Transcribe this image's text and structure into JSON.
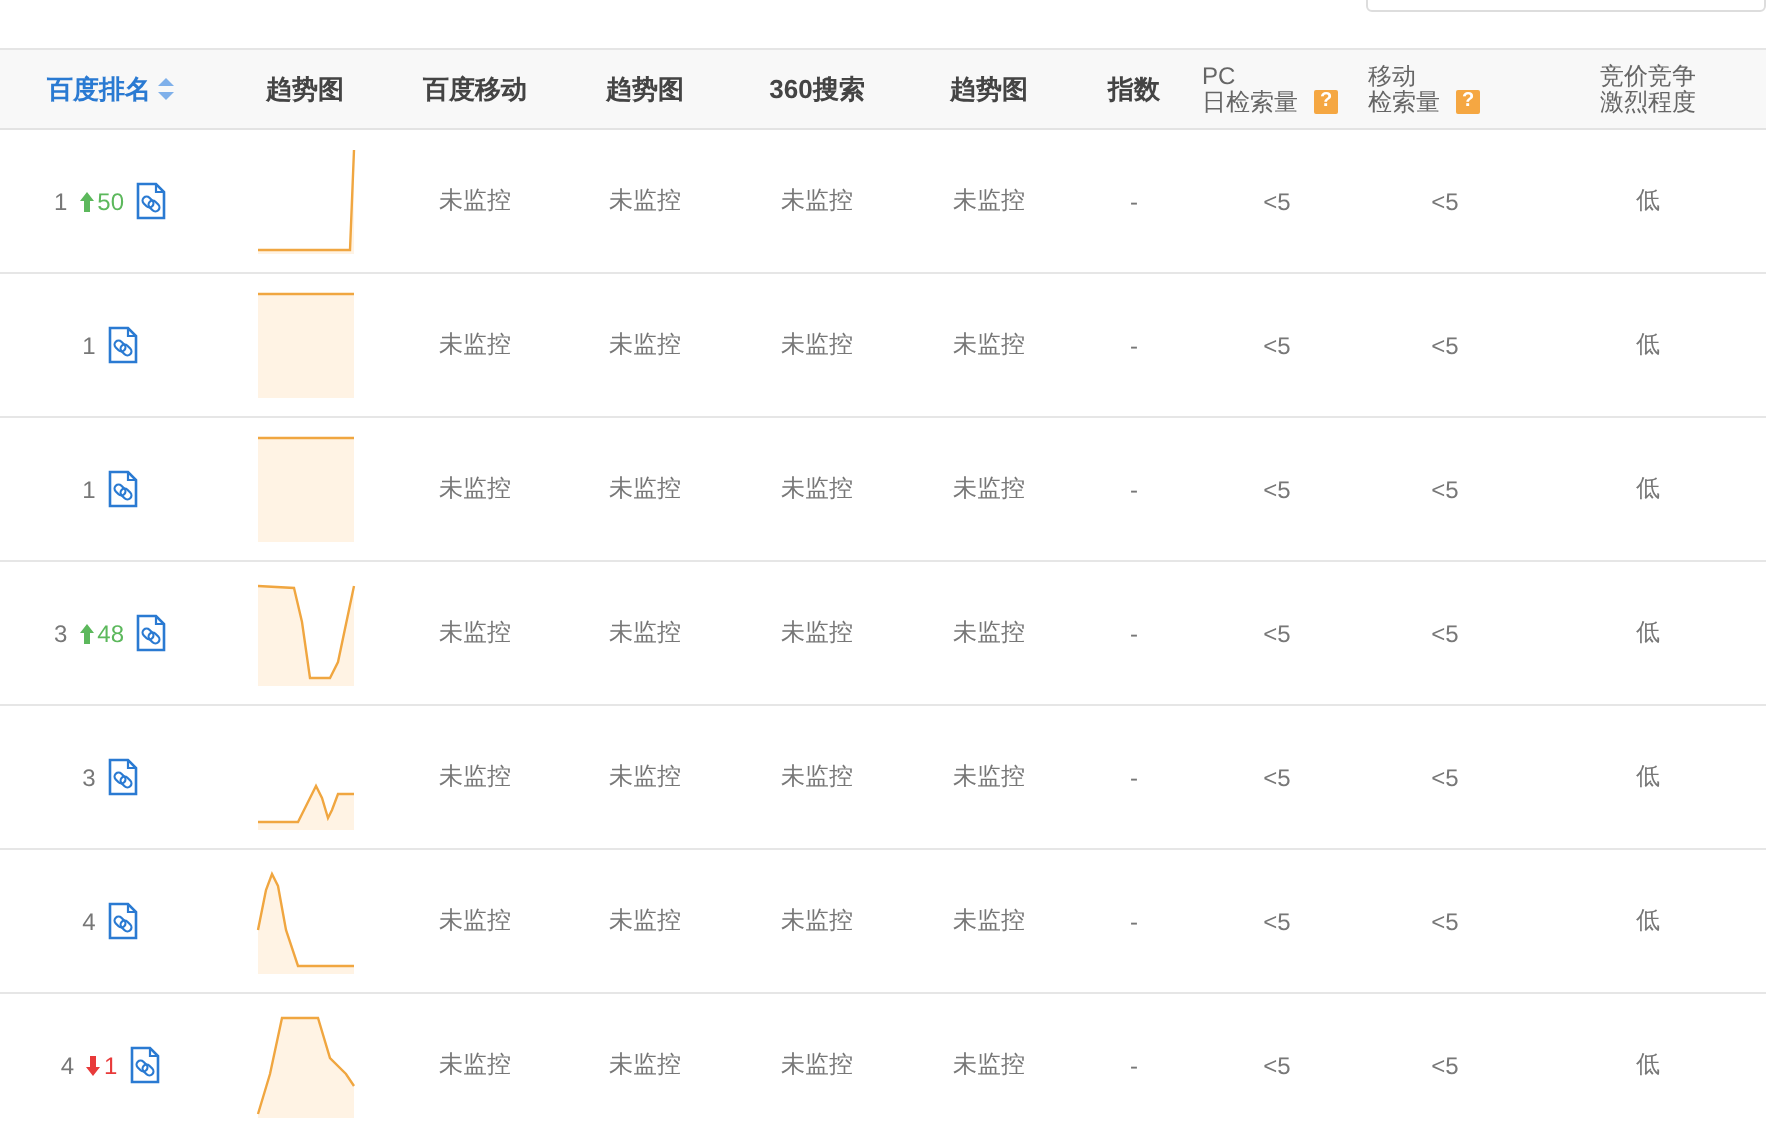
{
  "columns": [
    {
      "label": "百度排名",
      "active": true,
      "sortable": true
    },
    {
      "label": "趋势图"
    },
    {
      "label": "百度移动"
    },
    {
      "label": "趋势图"
    },
    {
      "label": "360搜索"
    },
    {
      "label": "趋势图"
    },
    {
      "label": "指数"
    },
    {
      "label": "PC",
      "label_2": "日检索量",
      "help": "?"
    },
    {
      "label": "移动",
      "label_2": "检索量",
      "help": "?"
    },
    {
      "label": "竞价竞争",
      "label_2": "激烈程度"
    }
  ],
  "rows": [
    {
      "rank": "1",
      "change": {
        "kind": "up",
        "value": "50"
      },
      "trend": {
        "kind": "rise"
      },
      "mobile": "未监控",
      "mobile_trend": "未监控",
      "so360": "未监控",
      "so360_trend": "未监控",
      "index": "-",
      "pc_volume": "<5",
      "mobile_volume": "<5",
      "competition": "低"
    },
    {
      "rank": "1",
      "trend": {
        "kind": "flat"
      },
      "mobile": "未监控",
      "mobile_trend": "未监控",
      "so360": "未监控",
      "so360_trend": "未监控",
      "index": "-",
      "pc_volume": "<5",
      "mobile_volume": "<5",
      "competition": "低"
    },
    {
      "rank": "1",
      "trend": {
        "kind": "flat"
      },
      "mobile": "未监控",
      "mobile_trend": "未监控",
      "so360": "未监控",
      "so360_trend": "未监控",
      "index": "-",
      "pc_volume": "<5",
      "mobile_volume": "<5",
      "competition": "低"
    },
    {
      "rank": "3",
      "change": {
        "kind": "up",
        "value": "48"
      },
      "trend": {
        "kind": "dip"
      },
      "mobile": "未监控",
      "mobile_trend": "未监控",
      "so360": "未监控",
      "so360_trend": "未监控",
      "index": "-",
      "pc_volume": "<5",
      "mobile_volume": "<5",
      "competition": "低"
    },
    {
      "rank": "3",
      "trend": {
        "kind": "wave"
      },
      "mobile": "未监控",
      "mobile_trend": "未监控",
      "so360": "未监控",
      "so360_trend": "未监控",
      "index": "-",
      "pc_volume": "<5",
      "mobile_volume": "<5",
      "competition": "低"
    },
    {
      "rank": "4",
      "trend": {
        "kind": "peak"
      },
      "mobile": "未监控",
      "mobile_trend": "未监控",
      "so360": "未监控",
      "so360_trend": "未监控",
      "index": "-",
      "pc_volume": "<5",
      "mobile_volume": "<5",
      "competition": "低"
    },
    {
      "rank": "4",
      "change": {
        "kind": "down",
        "value": "1"
      },
      "trend": {
        "kind": "plateau"
      },
      "mobile": "未监控",
      "mobile_trend": "未监控",
      "so360": "未监控",
      "so360_trend": "未监控",
      "index": "-",
      "pc_volume": "<5",
      "mobile_volume": "<5",
      "competition": "低"
    }
  ]
}
